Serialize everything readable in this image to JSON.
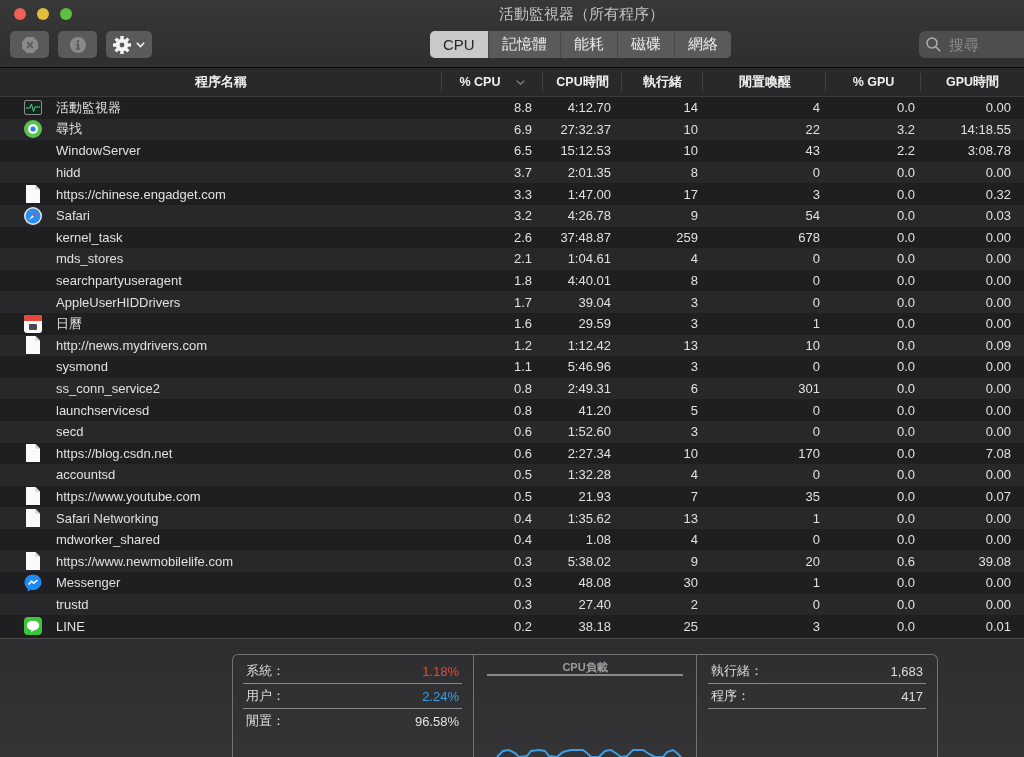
{
  "window": {
    "title": "活動監視器（所有程序）"
  },
  "toolbar": {
    "buttons": [
      {
        "kind": "stop",
        "disabled": true
      },
      {
        "kind": "info",
        "disabled": true
      },
      {
        "kind": "action",
        "disabled": false
      }
    ],
    "tabs": [
      {
        "label": "CPU",
        "selected": true
      },
      {
        "label": "記憶體",
        "selected": false
      },
      {
        "label": "能耗",
        "selected": false
      },
      {
        "label": "磁碟",
        "selected": false
      },
      {
        "label": "網絡",
        "selected": false
      }
    ],
    "search": {
      "placeholder": "搜尋"
    }
  },
  "table": {
    "columns": [
      {
        "label": "程序名稱",
        "sorted": false
      },
      {
        "label": "% CPU",
        "sorted": true
      },
      {
        "label": "CPU時間",
        "sorted": false
      },
      {
        "label": "執行緒",
        "sorted": false
      },
      {
        "label": "閒置喚醒",
        "sorted": false
      },
      {
        "label": "% GPU",
        "sorted": false
      },
      {
        "label": "GPU時間",
        "sorted": false
      }
    ],
    "rows": [
      {
        "kind": "monitor",
        "name": "活動監視器",
        "cpu": "8.8",
        "cpu_time": "4:12.70",
        "threads": "14",
        "idle_wakeups": "4",
        "gpu": "0.0",
        "gpu_time": "0.00"
      },
      {
        "kind": "locator",
        "name": "尋找",
        "cpu": "6.9",
        "cpu_time": "27:32.37",
        "threads": "10",
        "idle_wakeups": "22",
        "gpu": "3.2",
        "gpu_time": "14:18.55"
      },
      {
        "kind": "plain",
        "name": "WindowServer",
        "cpu": "6.5",
        "cpu_time": "15:12.53",
        "threads": "10",
        "idle_wakeups": "43",
        "gpu": "2.2",
        "gpu_time": "3:08.78"
      },
      {
        "kind": "plain",
        "name": "hidd",
        "cpu": "3.7",
        "cpu_time": "2:01.35",
        "threads": "8",
        "idle_wakeups": "0",
        "gpu": "0.0",
        "gpu_time": "0.00"
      },
      {
        "kind": "document",
        "name": "https://chinese.engadget.com",
        "cpu": "3.3",
        "cpu_time": "1:47.00",
        "threads": "17",
        "idle_wakeups": "3",
        "gpu": "0.0",
        "gpu_time": "0.32"
      },
      {
        "kind": "compass",
        "name": "Safari",
        "cpu": "3.2",
        "cpu_time": "4:26.78",
        "threads": "9",
        "idle_wakeups": "54",
        "gpu": "0.0",
        "gpu_time": "0.03"
      },
      {
        "kind": "plain",
        "name": "kernel_task",
        "cpu": "2.6",
        "cpu_time": "37:48.87",
        "threads": "259",
        "idle_wakeups": "678",
        "gpu": "0.0",
        "gpu_time": "0.00"
      },
      {
        "kind": "plain",
        "name": "mds_stores",
        "cpu": "2.1",
        "cpu_time": "1:04.61",
        "threads": "4",
        "idle_wakeups": "0",
        "gpu": "0.0",
        "gpu_time": "0.00"
      },
      {
        "kind": "plain",
        "name": "searchpartyuseragent",
        "cpu": "1.8",
        "cpu_time": "4:40.01",
        "threads": "8",
        "idle_wakeups": "0",
        "gpu": "0.0",
        "gpu_time": "0.00"
      },
      {
        "kind": "plain",
        "name": "AppleUserHIDDrivers",
        "cpu": "1.7",
        "cpu_time": "39.04",
        "threads": "3",
        "idle_wakeups": "0",
        "gpu": "0.0",
        "gpu_time": "0.00"
      },
      {
        "kind": "calendar",
        "name": "日曆",
        "cpu": "1.6",
        "cpu_time": "29.59",
        "threads": "3",
        "idle_wakeups": "1",
        "gpu": "0.0",
        "gpu_time": "0.00"
      },
      {
        "kind": "document",
        "name": "http://news.mydrivers.com",
        "cpu": "1.2",
        "cpu_time": "1:12.42",
        "threads": "13",
        "idle_wakeups": "10",
        "gpu": "0.0",
        "gpu_time": "0.09"
      },
      {
        "kind": "plain",
        "name": "sysmond",
        "cpu": "1.1",
        "cpu_time": "5:46.96",
        "threads": "3",
        "idle_wakeups": "0",
        "gpu": "0.0",
        "gpu_time": "0.00"
      },
      {
        "kind": "plain",
        "name": "ss_conn_service2",
        "cpu": "0.8",
        "cpu_time": "2:49.31",
        "threads": "6",
        "idle_wakeups": "301",
        "gpu": "0.0",
        "gpu_time": "0.00"
      },
      {
        "kind": "plain",
        "name": "launchservicesd",
        "cpu": "0.8",
        "cpu_time": "41.20",
        "threads": "5",
        "idle_wakeups": "0",
        "gpu": "0.0",
        "gpu_time": "0.00"
      },
      {
        "kind": "plain",
        "name": "secd",
        "cpu": "0.6",
        "cpu_time": "1:52.60",
        "threads": "3",
        "idle_wakeups": "0",
        "gpu": "0.0",
        "gpu_time": "0.00"
      },
      {
        "kind": "document",
        "name": "https://blog.csdn.net",
        "cpu": "0.6",
        "cpu_time": "2:27.34",
        "threads": "10",
        "idle_wakeups": "170",
        "gpu": "0.0",
        "gpu_time": "7.08"
      },
      {
        "kind": "plain",
        "name": "accountsd",
        "cpu": "0.5",
        "cpu_time": "1:32.28",
        "threads": "4",
        "idle_wakeups": "0",
        "gpu": "0.0",
        "gpu_time": "0.00"
      },
      {
        "kind": "document",
        "name": "https://www.youtube.com",
        "cpu": "0.5",
        "cpu_time": "21.93",
        "threads": "7",
        "idle_wakeups": "35",
        "gpu": "0.0",
        "gpu_time": "0.07"
      },
      {
        "kind": "document",
        "name": "Safari Networking",
        "cpu": "0.4",
        "cpu_time": "1:35.62",
        "threads": "13",
        "idle_wakeups": "1",
        "gpu": "0.0",
        "gpu_time": "0.00"
      },
      {
        "kind": "plain",
        "name": "mdworker_shared",
        "cpu": "0.4",
        "cpu_time": "1.08",
        "threads": "4",
        "idle_wakeups": "0",
        "gpu": "0.0",
        "gpu_time": "0.00"
      },
      {
        "kind": "document",
        "name": "https://www.newmobilelife.com",
        "cpu": "0.3",
        "cpu_time": "5:38.02",
        "threads": "9",
        "idle_wakeups": "20",
        "gpu": "0.6",
        "gpu_time": "39.08"
      },
      {
        "kind": "messenger",
        "name": "Messenger",
        "cpu": "0.3",
        "cpu_time": "48.08",
        "threads": "30",
        "idle_wakeups": "1",
        "gpu": "0.0",
        "gpu_time": "0.00"
      },
      {
        "kind": "plain",
        "name": "trustd",
        "cpu": "0.3",
        "cpu_time": "27.40",
        "threads": "2",
        "idle_wakeups": "0",
        "gpu": "0.0",
        "gpu_time": "0.00"
      },
      {
        "kind": "chat",
        "name": "LINE",
        "cpu": "0.2",
        "cpu_time": "38.18",
        "threads": "25",
        "idle_wakeups": "3",
        "gpu": "0.0",
        "gpu_time": "0.01"
      }
    ]
  },
  "summary": {
    "cpu_usage": [
      {
        "label": "系統：",
        "value": "1.18%",
        "color": "#e5473b"
      },
      {
        "label": "用户：",
        "value": "2.24%",
        "color": "#3d9de6"
      },
      {
        "label": "閒置：",
        "value": "96.58%",
        "color": "#e2e2e2"
      }
    ],
    "cpu_load": {
      "title": "CPU負載"
    },
    "counts": [
      {
        "label": "執行緒：",
        "value": "1,683"
      },
      {
        "label": "程序：",
        "value": "417"
      }
    ]
  }
}
